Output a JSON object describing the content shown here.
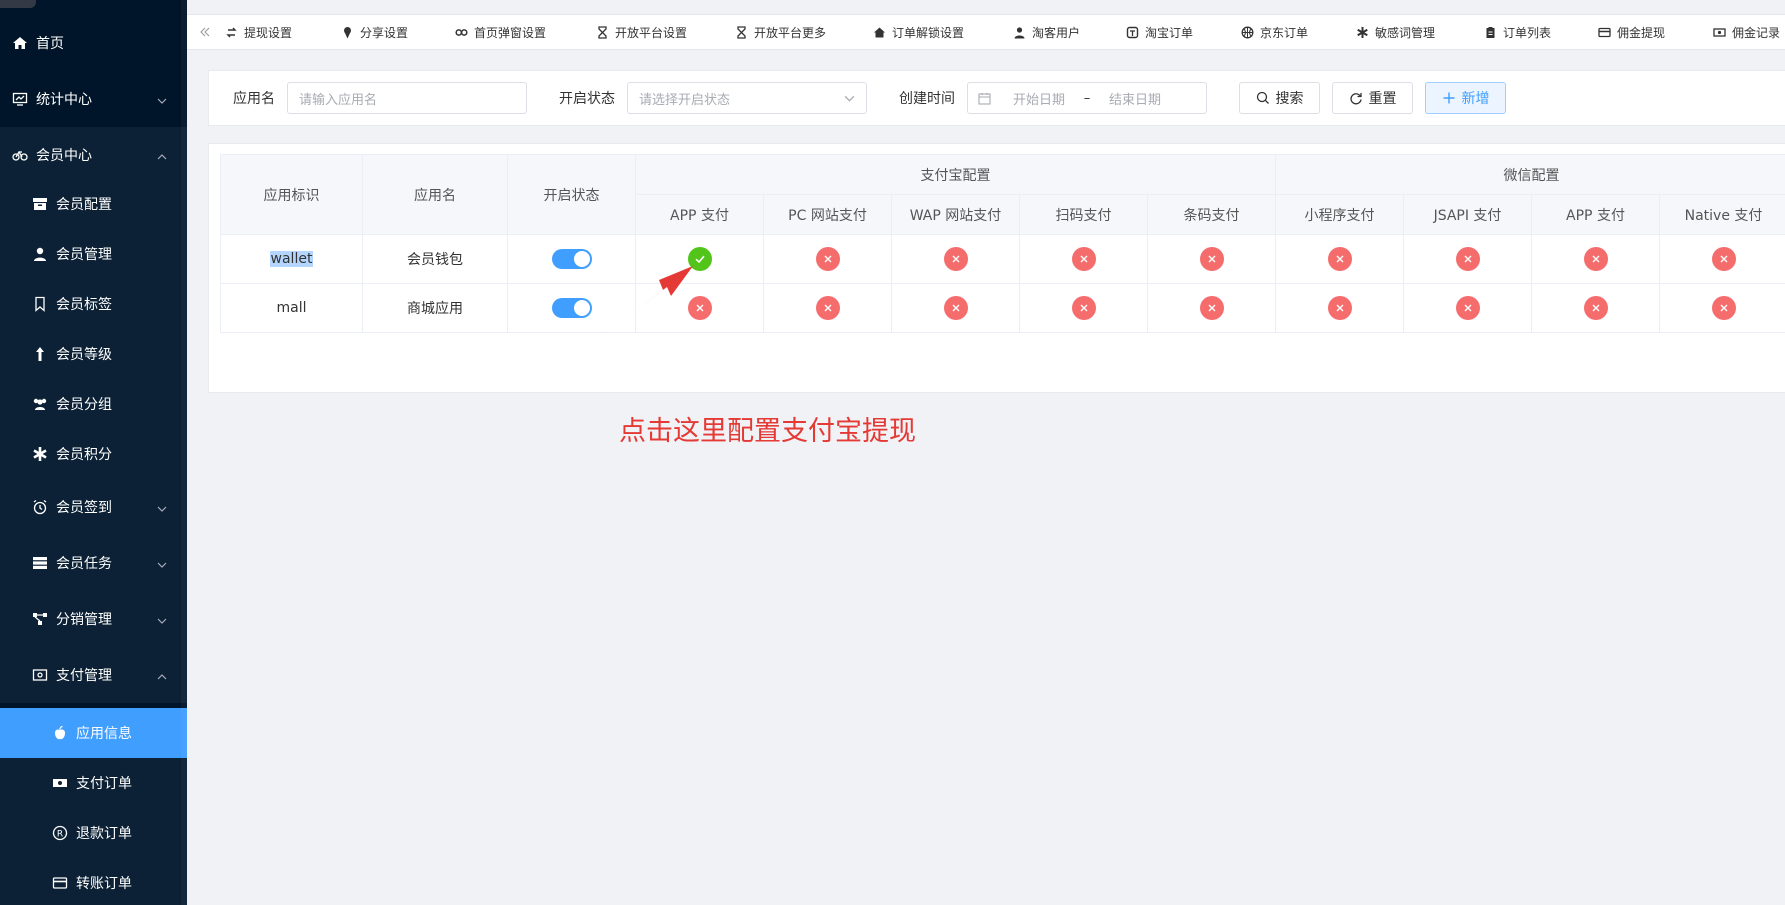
{
  "sidebar": {
    "items": [
      {
        "label": "首页",
        "icon": "home-icon"
      },
      {
        "label": "统计中心",
        "icon": "chart-icon"
      },
      {
        "label": "会员中心",
        "icon": "bike-icon"
      },
      {
        "label": "会员配置",
        "icon": "box-icon"
      },
      {
        "label": "会员管理",
        "icon": "user-icon"
      },
      {
        "label": "会员标签",
        "icon": "bookmark-icon"
      },
      {
        "label": "会员等级",
        "icon": "level-up-icon"
      },
      {
        "label": "会员分组",
        "icon": "users-icon"
      },
      {
        "label": "会员积分",
        "icon": "asterisk-icon"
      },
      {
        "label": "会员签到",
        "icon": "alarm-icon"
      },
      {
        "label": "会员任务",
        "icon": "server-icon"
      },
      {
        "label": "分销管理",
        "icon": "share-nodes-icon"
      },
      {
        "label": "支付管理",
        "icon": "wallet-icon"
      },
      {
        "label": "应用信息",
        "icon": "apple-icon"
      },
      {
        "label": "支付订单",
        "icon": "money-icon"
      },
      {
        "label": "退款订单",
        "icon": "registered-icon"
      },
      {
        "label": "转账订单",
        "icon": "credit-card-icon"
      }
    ]
  },
  "tabs": [
    {
      "label": "提现设置",
      "icon": "exchange-icon"
    },
    {
      "label": "分享设置",
      "icon": "ice-cream-icon"
    },
    {
      "label": "首页弹窗设置",
      "icon": "infinity-icon"
    },
    {
      "label": "开放平台设置",
      "icon": "hourglass-icon"
    },
    {
      "label": "开放平台更多",
      "icon": "hourglass-icon"
    },
    {
      "label": "订单解锁设置",
      "icon": "home-icon"
    },
    {
      "label": "淘客用户",
      "icon": "user-icon"
    },
    {
      "label": "淘宝订单",
      "icon": "taobao-icon"
    },
    {
      "label": "京东订单",
      "icon": "basketball-icon"
    },
    {
      "label": "敏感词管理",
      "icon": "asterisk-icon"
    },
    {
      "label": "订单列表",
      "icon": "clipboard-icon"
    },
    {
      "label": "佣金提现",
      "icon": "credit-card-icon"
    },
    {
      "label": "佣金记录",
      "icon": "money-icon"
    }
  ],
  "search": {
    "app_name_label": "应用名",
    "app_name_placeholder": "请输入应用名",
    "status_label": "开启状态",
    "status_placeholder": "请选择开启状态",
    "created_label": "创建时间",
    "start_placeholder": "开始日期",
    "range_sep": "–",
    "end_placeholder": "结束日期",
    "search_btn": "搜索",
    "reset_btn": "重置",
    "add_btn": "新增"
  },
  "table": {
    "col_app_id": "应用标识",
    "col_app_name": "应用名",
    "col_status": "开启状态",
    "group_alipay": "支付宝配置",
    "group_wechat": "微信配置",
    "alipay_cols": [
      "APP 支付",
      "PC 网站支付",
      "WAP 网站支付",
      "扫码支付",
      "条码支付"
    ],
    "wechat_cols": [
      "小程序支付",
      "JSAPI 支付",
      "APP 支付",
      "Native 支付"
    ],
    "rows": [
      {
        "app_id": "wallet",
        "app_name": "会员钱包",
        "enabled": true,
        "alipay": [
          true,
          false,
          false,
          false,
          false
        ],
        "wechat": [
          false,
          false,
          false,
          false
        ]
      },
      {
        "app_id": "mall",
        "app_name": "商城应用",
        "enabled": true,
        "alipay": [
          false,
          false,
          false,
          false,
          false
        ],
        "wechat": [
          false,
          false,
          false,
          false
        ]
      }
    ]
  },
  "annotation": {
    "text": "点击这里配置支付宝提现",
    "color": "#e53935"
  },
  "colors": {
    "sidebar_bg": "#001529",
    "accent": "#409eff",
    "ok": "#52c41a",
    "error": "#f56c6c"
  }
}
